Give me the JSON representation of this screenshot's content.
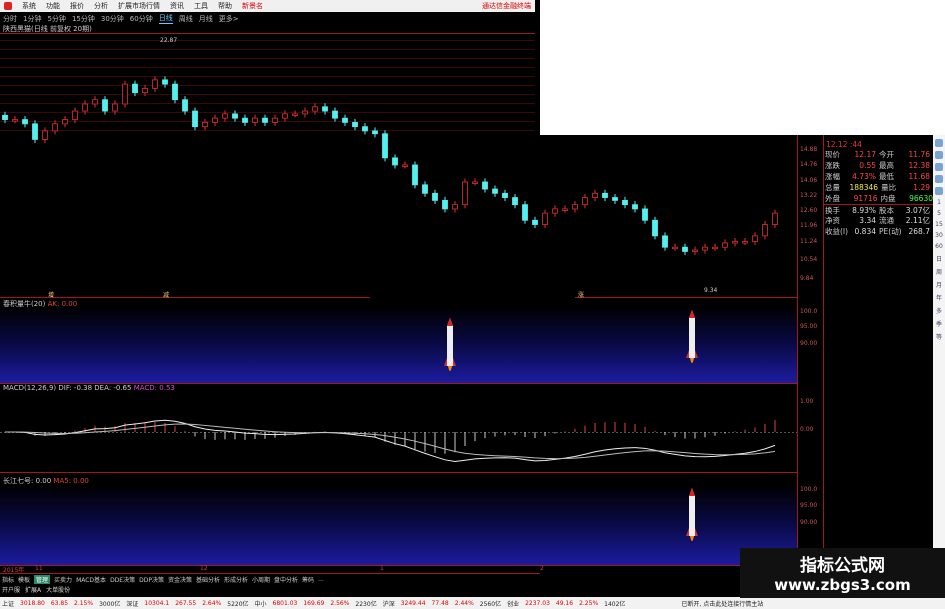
{
  "menu": {
    "items": [
      "系统",
      "功能",
      "报价",
      "分析",
      "扩展市场行情",
      "资讯",
      "工具",
      "帮助"
    ],
    "highlight": "新景名",
    "brand": "通达信金融终端"
  },
  "periods": [
    "分时",
    "1分钟",
    "5分钟",
    "15分钟",
    "30分钟",
    "60分钟",
    "日线",
    "周线",
    "月线",
    "更多>"
  ],
  "active_period": "日线",
  "chart_title": "陕西黑猫(日线 前复权 20期)",
  "price_chart": {
    "max_label": "22.87",
    "min_label": "9.34",
    "markers": [
      "增",
      "减",
      "涨"
    ],
    "scale": [
      "14.88",
      "14.76",
      "14.06",
      "13.22",
      "12.60",
      "11.96",
      "11.24",
      "10.54",
      "9.84"
    ],
    "closes": [
      17.4,
      17.4,
      17.1,
      16.0,
      16.6,
      17.1,
      17.4,
      18.0,
      18.5,
      18.8,
      18.0,
      18.5,
      19.9,
      19.3,
      19.6,
      20.2,
      19.9,
      18.8,
      18.0,
      16.9,
      17.2,
      17.5,
      17.8,
      17.5,
      17.2,
      17.5,
      17.2,
      17.5,
      17.8,
      17.8,
      18.0,
      18.3,
      18.0,
      17.5,
      17.2,
      16.9,
      16.6,
      16.4,
      14.7,
      14.2,
      14.2,
      12.8,
      12.2,
      11.7,
      11.1,
      11.4,
      13.0,
      13.0,
      12.5,
      12.2,
      11.9,
      11.4,
      10.3,
      10.0,
      10.8,
      11.1,
      11.1,
      11.4,
      11.9,
      12.2,
      11.9,
      11.7,
      11.4,
      11.1,
      10.3,
      9.2,
      8.4,
      8.4,
      8.1,
      8.2,
      8.4,
      8.4,
      8.7,
      8.8,
      8.8,
      9.2,
      10.0,
      10.8
    ],
    "up_color": "#e03030",
    "down_color": "#54f0f0"
  },
  "panel2": {
    "name": "春积量牛(20)",
    "value_label": "AK: 0.00",
    "scale": [
      "100.0",
      "95.00",
      "90.00"
    ]
  },
  "macd": {
    "label": "MACD(12,26,9)",
    "dif": "DIF: -0.38",
    "dea": "DEA: -0.65",
    "macd": "MACD: 0.53",
    "scale": [
      "1.00",
      "0.00"
    ]
  },
  "panel4": {
    "name": "长江七号: 0.00",
    "value_label": "MA5: 0.00",
    "scale": [
      "100.0",
      "95.00",
      "90.00"
    ]
  },
  "info": {
    "time": "12.12 :44",
    "rows": [
      [
        "现价",
        "12.17",
        "今开",
        "11.76"
      ],
      [
        "涨跌",
        "0.55",
        "最高",
        "12.38"
      ],
      [
        "涨幅",
        "4.73%",
        "最低",
        "11.68"
      ],
      [
        "总量",
        "188346",
        "量比",
        "1.29"
      ],
      [
        "外盘",
        "91716",
        "内盘",
        "96630"
      ],
      [
        "换手",
        "8.93%",
        "股本",
        "3.07亿"
      ],
      [
        "净资",
        "3.34",
        "流通",
        "2.11亿"
      ],
      [
        "收益(I)",
        "0.834",
        "PE(动)",
        "268.7"
      ]
    ]
  },
  "sidebar": [
    "1",
    "5",
    "15",
    "30",
    "60",
    "日",
    "周",
    "月",
    "年",
    "多",
    "季",
    "等"
  ],
  "dates": [
    "2015年",
    "11",
    "12",
    "1",
    "2"
  ],
  "tabs": [
    "指标",
    "模板",
    "管理",
    "买卖力",
    "MACD基本",
    "DDE决策",
    "DDP决策",
    "资金决策",
    "基础分析",
    "形成分析",
    "小周期",
    "盘中分析",
    "筹码",
    "..."
  ],
  "selected_tab": "管理",
  "subtabs": [
    "开户服",
    "扩展A",
    "大单股份"
  ],
  "status": [
    {
      "name": "上证",
      "v": "3018.80",
      "c": "63.85",
      "p": "2.15%",
      "amt": "3000亿"
    },
    {
      "name": "深证",
      "v": "10304.1",
      "c": "267.55",
      "p": "2.64%",
      "amt": "5220亿"
    },
    {
      "name": "中小",
      "v": "6801.03",
      "c": "169.69",
      "p": "2.56%",
      "amt": "2230亿"
    },
    {
      "name": "沪深",
      "v": "3249.44",
      "c": "77.48",
      "p": "2.44%",
      "amt": "2560亿"
    },
    {
      "name": "创业",
      "v": "2237.03",
      "c": "49.16",
      "p": "2.25%",
      "amt": "1402亿"
    }
  ],
  "status_tail": "已断开, 点击此处连接行情主站",
  "watermark": {
    "title": "指标公式网",
    "url": "www.zbgs3.com"
  }
}
